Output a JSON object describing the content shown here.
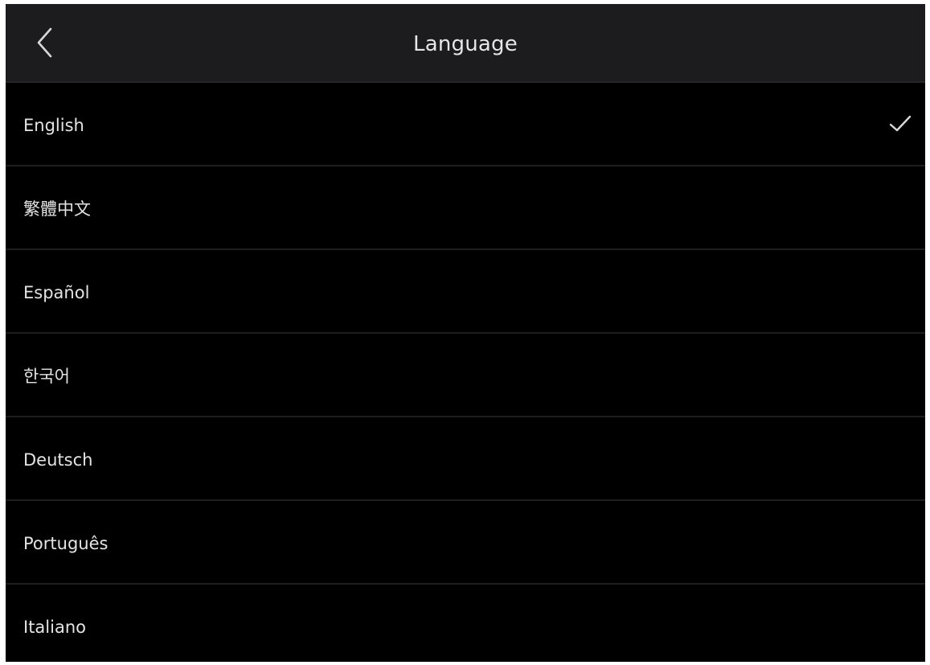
{
  "header": {
    "title": "Language",
    "back_icon": "chevron-left-icon"
  },
  "languages": {
    "selected": "English",
    "check_icon": "checkmark-icon",
    "items": [
      {
        "label": "English",
        "selected": true
      },
      {
        "label": "繁體中文",
        "selected": false
      },
      {
        "label": "Español",
        "selected": false
      },
      {
        "label": "한국어",
        "selected": false
      },
      {
        "label": "Deutsch",
        "selected": false
      },
      {
        "label": "Português",
        "selected": false
      },
      {
        "label": "Italiano",
        "selected": false
      }
    ]
  },
  "colors": {
    "background": "#000000",
    "header_background": "#1c1c1e",
    "divider": "#1e1e20",
    "text": "#e4e4e4"
  }
}
